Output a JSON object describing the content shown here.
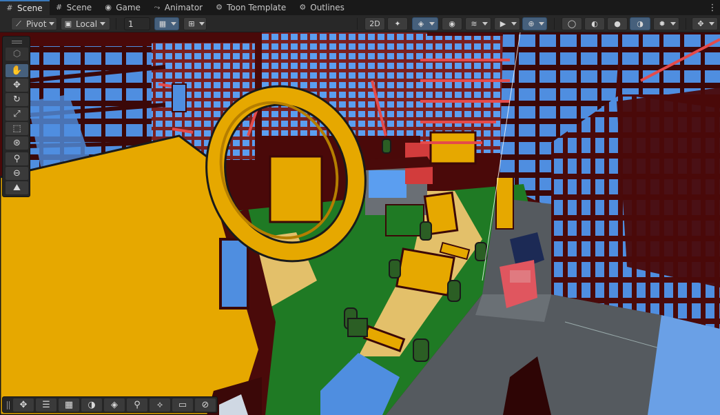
{
  "tabs": [
    {
      "label": "Scene",
      "icon": "hash-icon",
      "glyph": "#",
      "active": true
    },
    {
      "label": "Scene",
      "icon": "hash-icon",
      "glyph": "#",
      "active": false
    },
    {
      "label": "Game",
      "icon": "gamepad-icon",
      "glyph": "◉",
      "active": false
    },
    {
      "label": "Animator",
      "icon": "animator-icon",
      "glyph": "⤳",
      "active": false
    },
    {
      "label": "Toon Template",
      "icon": "gear-icon",
      "glyph": "⚙",
      "active": false
    },
    {
      "label": "Outlines",
      "icon": "gear-icon",
      "glyph": "⚙",
      "active": false
    }
  ],
  "toolbar": {
    "pivot_label": "Pivot",
    "local_label": "Local",
    "grid_snap_value": "1"
  },
  "colors": {
    "accent": "#46607c",
    "tab_active_border": "#3a79bb",
    "sky": "#4f8ee0",
    "grass": "#1f7a24",
    "ring_gold": "#e6a800",
    "building_maroon": "#5a0d0d",
    "asphalt": "#555a5f"
  }
}
